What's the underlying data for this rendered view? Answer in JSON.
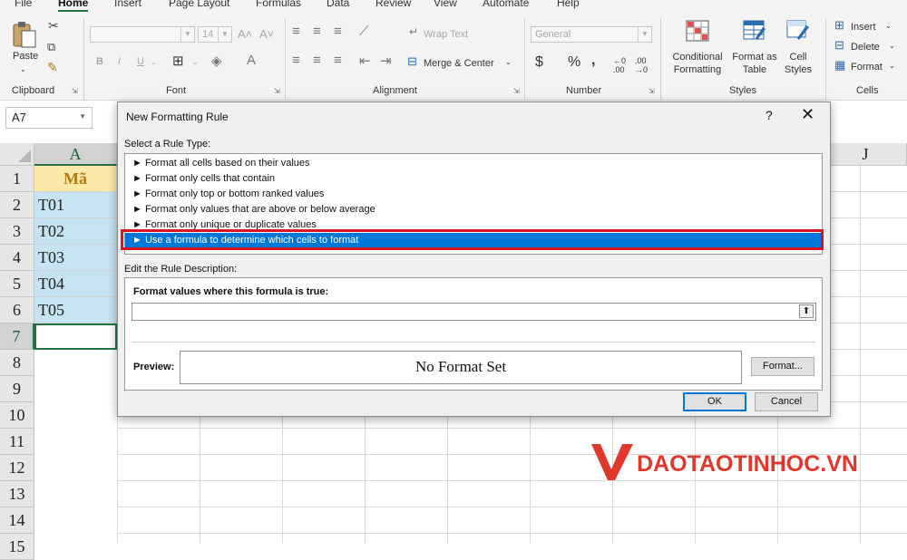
{
  "ribbon": {
    "tabs": [
      "File",
      "Home",
      "Insert",
      "Page Layout",
      "Formulas",
      "Data",
      "Review",
      "View",
      "Automate",
      "Help"
    ],
    "active_tab": "Home",
    "clipboard": {
      "paste_label": "Paste",
      "group_label": "Clipboard"
    },
    "font": {
      "size_value": "14",
      "bold": "B",
      "italic": "I",
      "underline": "U",
      "group_label": "Font"
    },
    "alignment": {
      "wrap_text": "Wrap Text",
      "merge_center": "Merge & Center",
      "group_label": "Alignment"
    },
    "number": {
      "format_value": "General",
      "currency": "$",
      "percent": "%",
      "comma": ",",
      "group_label": "Number"
    },
    "styles": {
      "conditional_formatting": "Conditional Formatting",
      "format_as_table": "Format as Table",
      "cell_styles": "Cell Styles",
      "group_label": "Styles"
    },
    "cells": {
      "insert": "Insert",
      "delete": "Delete",
      "format": "Format",
      "group_label": "Cells"
    }
  },
  "name_box": {
    "value": "A7"
  },
  "grid": {
    "columns": [
      "A",
      "J"
    ],
    "rows": [
      "1",
      "2",
      "3",
      "4",
      "5",
      "6",
      "7",
      "8",
      "9",
      "10",
      "11",
      "12",
      "13",
      "14",
      "15"
    ],
    "column_a_cells": [
      "Mã",
      "T01",
      "T02",
      "T03",
      "T04",
      "T05",
      ""
    ]
  },
  "dialog": {
    "title": "New Formatting Rule",
    "help": "?",
    "close": "✕",
    "select_rule_type_label": "Select a Rule Type:",
    "rule_types": [
      "► Format all cells based on their values",
      "► Format only cells that contain",
      "► Format only top or bottom ranked values",
      "► Format only values that are above or below average",
      "► Format only unique or duplicate values",
      "► Use a formula to determine which cells to format"
    ],
    "selected_rule_index": 5,
    "edit_description_label": "Edit the Rule Description:",
    "formula_label": "Format values where this formula is true:",
    "formula_value": "",
    "preview_label": "Preview:",
    "preview_text": "No Format Set",
    "format_button": "Format...",
    "ok_button": "OK",
    "cancel_button": "Cancel"
  },
  "watermark": {
    "text": "DAOTAOTINHOC.VN"
  },
  "colors": {
    "excel_green": "#217346",
    "selection_blue": "#0078d7",
    "highlight_red": "#d7141f",
    "header_fill": "#fde9a7",
    "data_fill": "#c5e3f1"
  }
}
